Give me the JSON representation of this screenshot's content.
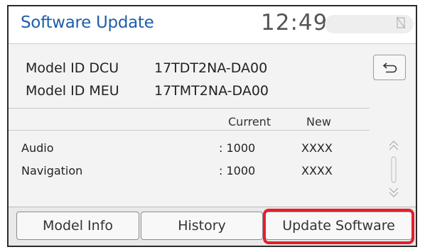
{
  "header": {
    "title": "Software Update",
    "clock": "12:49"
  },
  "model_info": [
    {
      "label": "Model ID DCU",
      "value": "17TDT2NA-DA00"
    },
    {
      "label": "Model ID MEU",
      "value": "17TMT2NA-DA00"
    }
  ],
  "table": {
    "col_current": "Current",
    "col_new": "New",
    "rows": [
      {
        "name": "Audio",
        "current": ": 1000",
        "new": "XXXX"
      },
      {
        "name": "Navigation",
        "current": ": 1000",
        "new": "XXXX"
      }
    ]
  },
  "tabs": {
    "model_info": "Model Info",
    "history": "History",
    "update_software": "Update Software"
  },
  "colors": {
    "title": "#1f5fa8",
    "highlight": "#e41f2a"
  },
  "icons": {
    "back": "back-arrow-icon",
    "no_signal": "no-signal-icon",
    "scroll_up": "chevron-double-up-icon",
    "scroll_down": "chevron-double-down-icon"
  }
}
